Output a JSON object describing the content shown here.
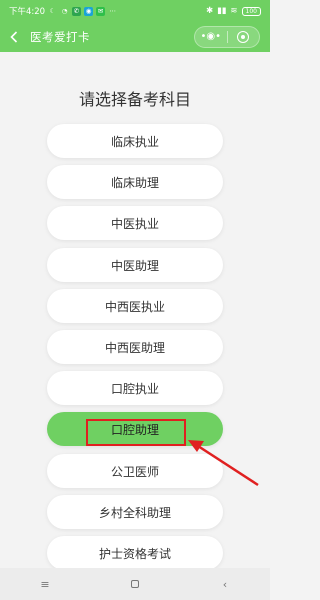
{
  "status_bar": {
    "time": "下午4:20",
    "battery": "100"
  },
  "nav": {
    "title": "医考爱打卡",
    "back_icon": "back-chevron-icon",
    "more_icon": "more-dots-icon",
    "close_icon": "target-circle-icon"
  },
  "page": {
    "title": "请选择备考科目"
  },
  "subjects": [
    {
      "label": "临床执业",
      "selected": false
    },
    {
      "label": "临床助理",
      "selected": false
    },
    {
      "label": "中医执业",
      "selected": false
    },
    {
      "label": "中医助理",
      "selected": false
    },
    {
      "label": "中西医执业",
      "selected": false
    },
    {
      "label": "中西医助理",
      "selected": false
    },
    {
      "label": "口腔执业",
      "selected": false
    },
    {
      "label": "口腔助理",
      "selected": true
    },
    {
      "label": "公卫医师",
      "selected": false
    },
    {
      "label": "乡村全科助理",
      "selected": false
    },
    {
      "label": "护士资格考试",
      "selected": false
    }
  ],
  "colors": {
    "accent": "#6fd062",
    "annotation": "#e02020"
  },
  "system_nav": {
    "menu_icon": "menu-lines-icon",
    "home_icon": "home-square-icon",
    "back_icon": "back-triangle-icon"
  }
}
